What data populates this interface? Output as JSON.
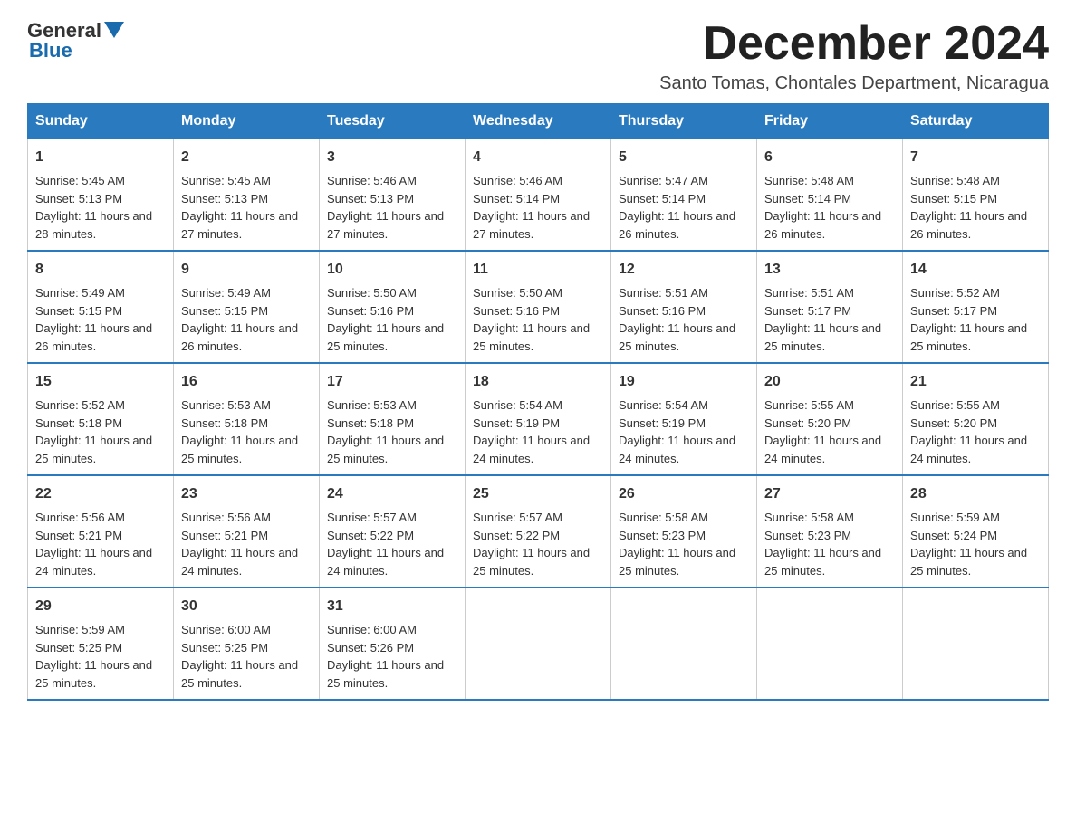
{
  "header": {
    "logo_general": "General",
    "logo_blue": "Blue",
    "month_title": "December 2024",
    "subtitle": "Santo Tomas, Chontales Department, Nicaragua"
  },
  "weekdays": [
    "Sunday",
    "Monday",
    "Tuesday",
    "Wednesday",
    "Thursday",
    "Friday",
    "Saturday"
  ],
  "weeks": [
    [
      {
        "day": "1",
        "sunrise": "5:45 AM",
        "sunset": "5:13 PM",
        "daylight": "11 hours and 28 minutes."
      },
      {
        "day": "2",
        "sunrise": "5:45 AM",
        "sunset": "5:13 PM",
        "daylight": "11 hours and 27 minutes."
      },
      {
        "day": "3",
        "sunrise": "5:46 AM",
        "sunset": "5:13 PM",
        "daylight": "11 hours and 27 minutes."
      },
      {
        "day": "4",
        "sunrise": "5:46 AM",
        "sunset": "5:14 PM",
        "daylight": "11 hours and 27 minutes."
      },
      {
        "day": "5",
        "sunrise": "5:47 AM",
        "sunset": "5:14 PM",
        "daylight": "11 hours and 26 minutes."
      },
      {
        "day": "6",
        "sunrise": "5:48 AM",
        "sunset": "5:14 PM",
        "daylight": "11 hours and 26 minutes."
      },
      {
        "day": "7",
        "sunrise": "5:48 AM",
        "sunset": "5:15 PM",
        "daylight": "11 hours and 26 minutes."
      }
    ],
    [
      {
        "day": "8",
        "sunrise": "5:49 AM",
        "sunset": "5:15 PM",
        "daylight": "11 hours and 26 minutes."
      },
      {
        "day": "9",
        "sunrise": "5:49 AM",
        "sunset": "5:15 PM",
        "daylight": "11 hours and 26 minutes."
      },
      {
        "day": "10",
        "sunrise": "5:50 AM",
        "sunset": "5:16 PM",
        "daylight": "11 hours and 25 minutes."
      },
      {
        "day": "11",
        "sunrise": "5:50 AM",
        "sunset": "5:16 PM",
        "daylight": "11 hours and 25 minutes."
      },
      {
        "day": "12",
        "sunrise": "5:51 AM",
        "sunset": "5:16 PM",
        "daylight": "11 hours and 25 minutes."
      },
      {
        "day": "13",
        "sunrise": "5:51 AM",
        "sunset": "5:17 PM",
        "daylight": "11 hours and 25 minutes."
      },
      {
        "day": "14",
        "sunrise": "5:52 AM",
        "sunset": "5:17 PM",
        "daylight": "11 hours and 25 minutes."
      }
    ],
    [
      {
        "day": "15",
        "sunrise": "5:52 AM",
        "sunset": "5:18 PM",
        "daylight": "11 hours and 25 minutes."
      },
      {
        "day": "16",
        "sunrise": "5:53 AM",
        "sunset": "5:18 PM",
        "daylight": "11 hours and 25 minutes."
      },
      {
        "day": "17",
        "sunrise": "5:53 AM",
        "sunset": "5:18 PM",
        "daylight": "11 hours and 25 minutes."
      },
      {
        "day": "18",
        "sunrise": "5:54 AM",
        "sunset": "5:19 PM",
        "daylight": "11 hours and 24 minutes."
      },
      {
        "day": "19",
        "sunrise": "5:54 AM",
        "sunset": "5:19 PM",
        "daylight": "11 hours and 24 minutes."
      },
      {
        "day": "20",
        "sunrise": "5:55 AM",
        "sunset": "5:20 PM",
        "daylight": "11 hours and 24 minutes."
      },
      {
        "day": "21",
        "sunrise": "5:55 AM",
        "sunset": "5:20 PM",
        "daylight": "11 hours and 24 minutes."
      }
    ],
    [
      {
        "day": "22",
        "sunrise": "5:56 AM",
        "sunset": "5:21 PM",
        "daylight": "11 hours and 24 minutes."
      },
      {
        "day": "23",
        "sunrise": "5:56 AM",
        "sunset": "5:21 PM",
        "daylight": "11 hours and 24 minutes."
      },
      {
        "day": "24",
        "sunrise": "5:57 AM",
        "sunset": "5:22 PM",
        "daylight": "11 hours and 24 minutes."
      },
      {
        "day": "25",
        "sunrise": "5:57 AM",
        "sunset": "5:22 PM",
        "daylight": "11 hours and 25 minutes."
      },
      {
        "day": "26",
        "sunrise": "5:58 AM",
        "sunset": "5:23 PM",
        "daylight": "11 hours and 25 minutes."
      },
      {
        "day": "27",
        "sunrise": "5:58 AM",
        "sunset": "5:23 PM",
        "daylight": "11 hours and 25 minutes."
      },
      {
        "day": "28",
        "sunrise": "5:59 AM",
        "sunset": "5:24 PM",
        "daylight": "11 hours and 25 minutes."
      }
    ],
    [
      {
        "day": "29",
        "sunrise": "5:59 AM",
        "sunset": "5:25 PM",
        "daylight": "11 hours and 25 minutes."
      },
      {
        "day": "30",
        "sunrise": "6:00 AM",
        "sunset": "5:25 PM",
        "daylight": "11 hours and 25 minutes."
      },
      {
        "day": "31",
        "sunrise": "6:00 AM",
        "sunset": "5:26 PM",
        "daylight": "11 hours and 25 minutes."
      },
      null,
      null,
      null,
      null
    ]
  ],
  "labels": {
    "sunrise": "Sunrise:",
    "sunset": "Sunset:",
    "daylight": "Daylight:"
  }
}
